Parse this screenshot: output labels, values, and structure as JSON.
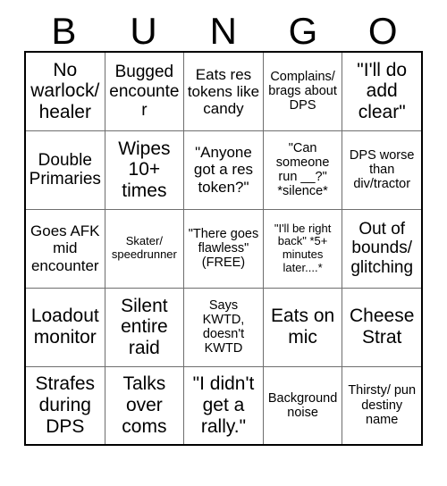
{
  "card": {
    "title": "BUNGO",
    "header_letters": [
      "B",
      "U",
      "N",
      "G",
      "O"
    ],
    "grid_size": "5x5",
    "text_color": "#000000",
    "background_color": "#ffffff",
    "border_color": "#6e6e6e",
    "outer_border_color": "#000000",
    "rows": [
      [
        {
          "text": "No warlock/ healer",
          "size": "fs-xl"
        },
        {
          "text": "Bugged encounter",
          "size": "fs-lg"
        },
        {
          "text": "Eats res tokens like candy",
          "size": "fs-md"
        },
        {
          "text": "Complains/ brags about DPS",
          "size": "fs-sm"
        },
        {
          "text": "\"I'll do add clear\"",
          "size": "fs-xl"
        }
      ],
      [
        {
          "text": "Double Primaries",
          "size": "fs-lg"
        },
        {
          "text": "Wipes 10+ times",
          "size": "fs-xl"
        },
        {
          "text": "\"Anyone got a res token?\"",
          "size": "fs-md"
        },
        {
          "text": "\"Can someone run __?\" *silence*",
          "size": "fs-sm"
        },
        {
          "text": "DPS worse than div/tractor",
          "size": "fs-sm"
        }
      ],
      [
        {
          "text": "Goes AFK mid encounter",
          "size": "fs-md"
        },
        {
          "text": "Skater/ speedrunner",
          "size": "fs-xs"
        },
        {
          "text": "\"There goes flawless\" (FREE)",
          "size": "fs-sm"
        },
        {
          "text": "\"I'll be right back\" *5+ minutes later....*",
          "size": "fs-xs"
        },
        {
          "text": "Out of bounds/ glitching",
          "size": "fs-lg"
        }
      ],
      [
        {
          "text": "Loadout monitor",
          "size": "fs-xl"
        },
        {
          "text": "Silent entire raid",
          "size": "fs-xl"
        },
        {
          "text": "Says KWTD, doesn't KWTD",
          "size": "fs-sm"
        },
        {
          "text": "Eats on mic",
          "size": "fs-xl"
        },
        {
          "text": "Cheese Strat",
          "size": "fs-xl"
        }
      ],
      [
        {
          "text": "Strafes during DPS",
          "size": "fs-xl"
        },
        {
          "text": "Talks over coms",
          "size": "fs-xl"
        },
        {
          "text": "\"I didn't get a rally.\"",
          "size": "fs-xl"
        },
        {
          "text": "Background noise",
          "size": "fs-sm"
        },
        {
          "text": "Thirsty/ pun destiny name",
          "size": "fs-sm"
        }
      ]
    ]
  }
}
